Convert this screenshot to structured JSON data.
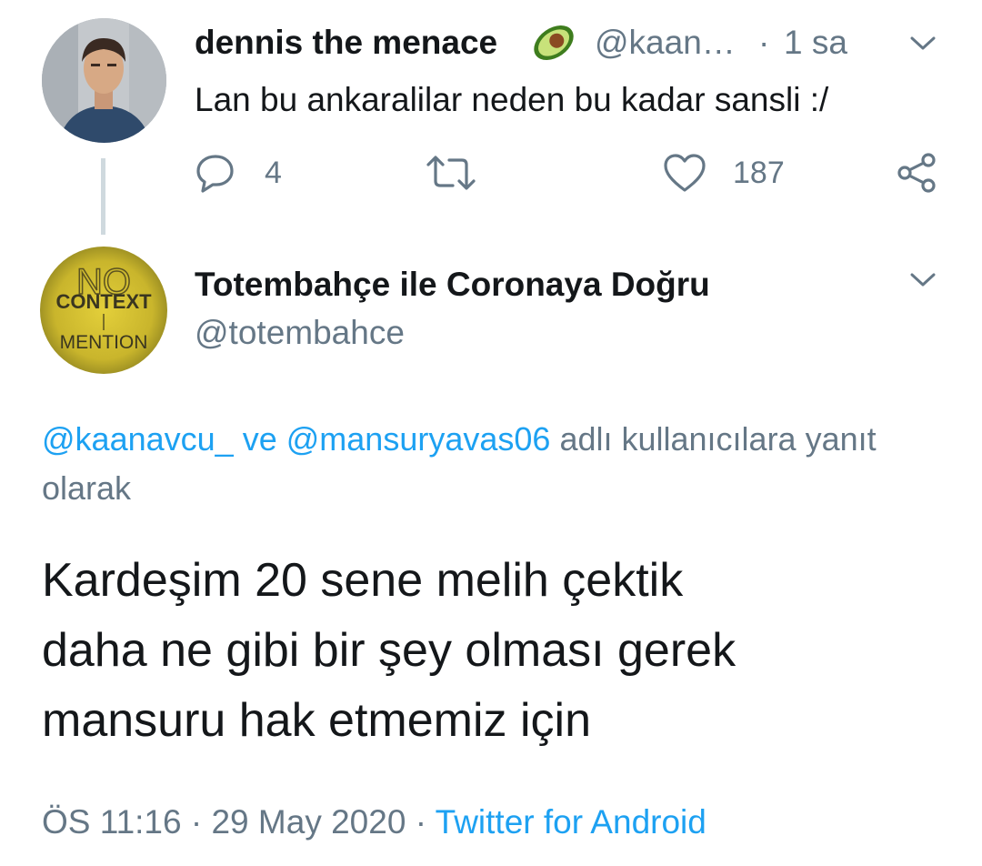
{
  "tweet1": {
    "display_name": "dennis the menace",
    "emoji_icon": "avocado-icon",
    "handle": "@kaan…",
    "separator": "·",
    "time": "1 sa",
    "text": "Lan bu ankaralilar neden bu kadar sansli :/",
    "reply_count": "4",
    "like_count": "187"
  },
  "tweet2": {
    "display_name": "Totembahçe ile Coronaya Doğru",
    "handle": "@totembahce",
    "avatar_text": {
      "line1": "CONTEXT",
      "line2": "MENTION"
    },
    "replying_to": {
      "user1": "@kaanavcu_",
      "conjunction": "ve",
      "user2": "@mansuryavas06",
      "suffix": "adlı kullanıcılara yanıt olarak"
    },
    "body_lines": [
      "Kardeşim 20 sene melih çektik",
      "daha ne gibi bir şey olması gerek",
      "mansuru hak etmemiz için"
    ],
    "time": "ÖS 11:16",
    "separator": "·",
    "date": "29 May 2020",
    "source": "Twitter for Android"
  },
  "colors": {
    "text": "#14171a",
    "secondary": "#657786",
    "link": "#1da1f2",
    "thread_line": "#cfd9de"
  }
}
